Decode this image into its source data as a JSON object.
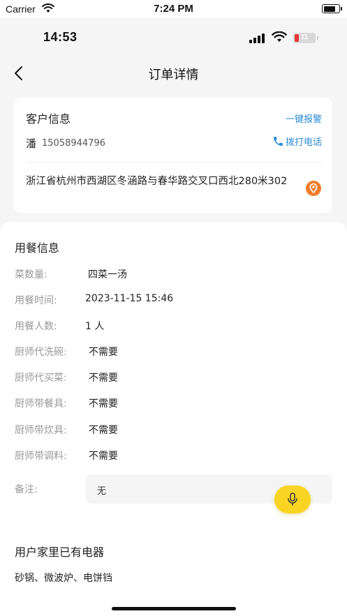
{
  "device_status": {
    "carrier": "Carrier",
    "time": "7:24 PM"
  },
  "inner_status": {
    "time": "14:53",
    "battery": "11"
  },
  "nav": {
    "title": "订单详情"
  },
  "customer": {
    "title": "客户信息",
    "alarm_label": "一键报警",
    "name": "潘",
    "phone": "15058944796",
    "call_label": "拨打电话",
    "address": "浙江省杭州市西湖区冬涵路与春华路交叉口西北280米302"
  },
  "meal_info": {
    "title": "用餐信息",
    "rows": [
      {
        "label": "菜数量:",
        "value": "四菜一汤"
      },
      {
        "label": "用餐时间:",
        "value": "2023-11-15 15:46"
      },
      {
        "label": "用餐人数:",
        "value": "1 人"
      },
      {
        "label": "厨师代洗碗:",
        "value": "不需要"
      },
      {
        "label": "厨师代买菜:",
        "value": "不需要"
      },
      {
        "label": "厨师带餐具:",
        "value": "不需要"
      },
      {
        "label": "厨师带炊具:",
        "value": "不需要"
      },
      {
        "label": "厨师带调料:",
        "value": "不需要"
      }
    ],
    "remark_label": "备注:",
    "remark_value": "无"
  },
  "appliances": {
    "title": "用户家里已有电器",
    "items": "砂锅、微波炉、电饼铛"
  },
  "colors": {
    "link_blue": "#2a8bd9",
    "location_orange": "#f07c2a",
    "mic_yellow": "#f9d423",
    "battery_red": "#e53935"
  },
  "icons": [
    "wifi-icon",
    "cellular-signal-icon",
    "battery-icon",
    "back-arrow-icon",
    "phone-icon",
    "location-pin-icon",
    "microphone-icon"
  ]
}
